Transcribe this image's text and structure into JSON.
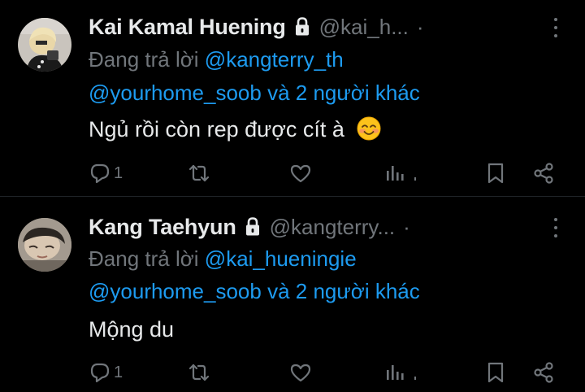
{
  "colors": {
    "background": "#000000",
    "text_primary": "#e7e9ea",
    "text_secondary": "#71767b",
    "link": "#1d9bf0"
  },
  "tweets": [
    {
      "display_name": "Kai Kamal Huening",
      "handle": "@kai_h...",
      "separator": "·",
      "protected_icon": "lock-icon",
      "reply_prefix": "Đang trả lời",
      "reply_to_primary": "@kangterry_th",
      "reply_to_secondary": "@yourhome_soob",
      "reply_others": "và 2 người khác",
      "text": "Ngủ rồi còn rep được cít à",
      "emoji": "smiling-face-with-smiling-eyes",
      "reply_count": "1",
      "repost_count": "",
      "like_count": "",
      "view_count": ""
    },
    {
      "display_name": "Kang Taehyun",
      "handle": "@kangterry...",
      "separator": "·",
      "protected_icon": "lock-icon",
      "reply_prefix": "Đang trả lời",
      "reply_to_primary": "@kai_hueningie",
      "reply_to_secondary": "@yourhome_soob",
      "reply_others": "và 2 người khác",
      "text": "Mộng du",
      "emoji": "",
      "reply_count": "1",
      "repost_count": "",
      "like_count": "",
      "view_count": ""
    }
  ]
}
